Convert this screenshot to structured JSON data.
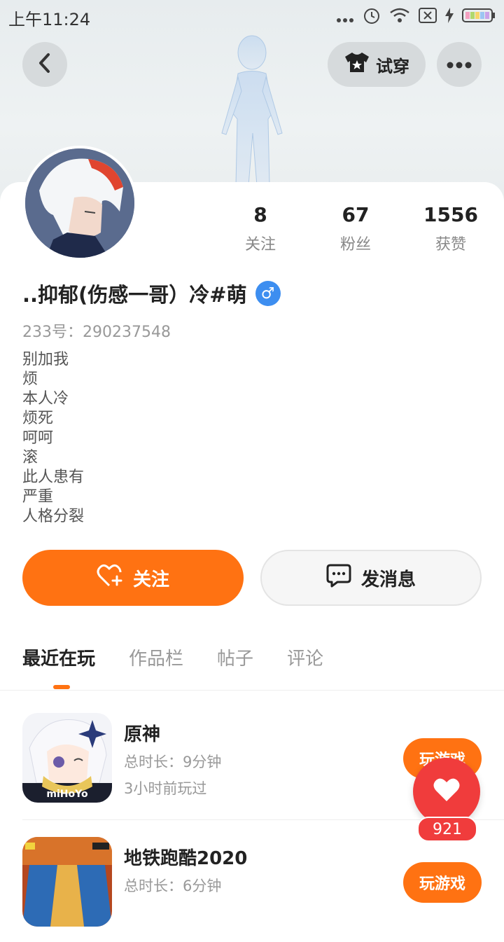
{
  "status_bar": {
    "time": "上午11:24"
  },
  "header": {
    "try_on_label": "试穿"
  },
  "stats": [
    {
      "value": "8",
      "label": "关注"
    },
    {
      "value": "67",
      "label": "粉丝"
    },
    {
      "value": "1556",
      "label": "获赞"
    }
  ],
  "profile": {
    "username": "..抑郁(伤感一哥）冷#萌",
    "gender_symbol": "♂",
    "uid": "233号：290237548",
    "bio": [
      "别加我",
      "烦",
      "本人冷",
      "烦死",
      "呵呵",
      "滚",
      "此人患有",
      "严重",
      "人格分裂"
    ]
  },
  "actions": {
    "follow_label": "关注",
    "message_label": "发消息"
  },
  "tabs": [
    {
      "label": "最近在玩",
      "active": true
    },
    {
      "label": "作品栏",
      "active": false
    },
    {
      "label": "帖子",
      "active": false
    },
    {
      "label": "评论",
      "active": false
    }
  ],
  "games": [
    {
      "name": "原神",
      "total_time": "总时长：9分钟",
      "last_played": "3小时前玩过",
      "play_label": "玩游戏",
      "icon_caption": "miHoYo"
    },
    {
      "name": "地铁跑酷2020",
      "total_time": "总时长：6分钟",
      "last_played": "",
      "play_label": "玩游戏"
    }
  ],
  "floating": {
    "like_count": "921"
  },
  "colors": {
    "accent": "#ff7212",
    "like": "#f03c3c",
    "gender": "#3d8ef0"
  }
}
